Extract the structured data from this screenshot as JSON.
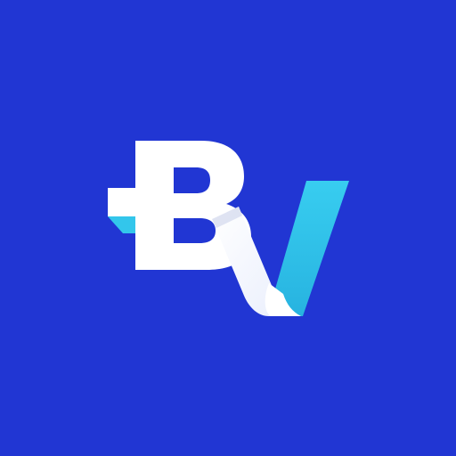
{
  "icon": {
    "name": "bv-logo-icon",
    "lettering": "BV",
    "colors": {
      "background": "#2136d3",
      "letter_b": "#ffffff",
      "letter_v_main": "#ffffff",
      "letter_v_accent": "#33c6eb",
      "shadow": "#0d1a6e"
    }
  }
}
